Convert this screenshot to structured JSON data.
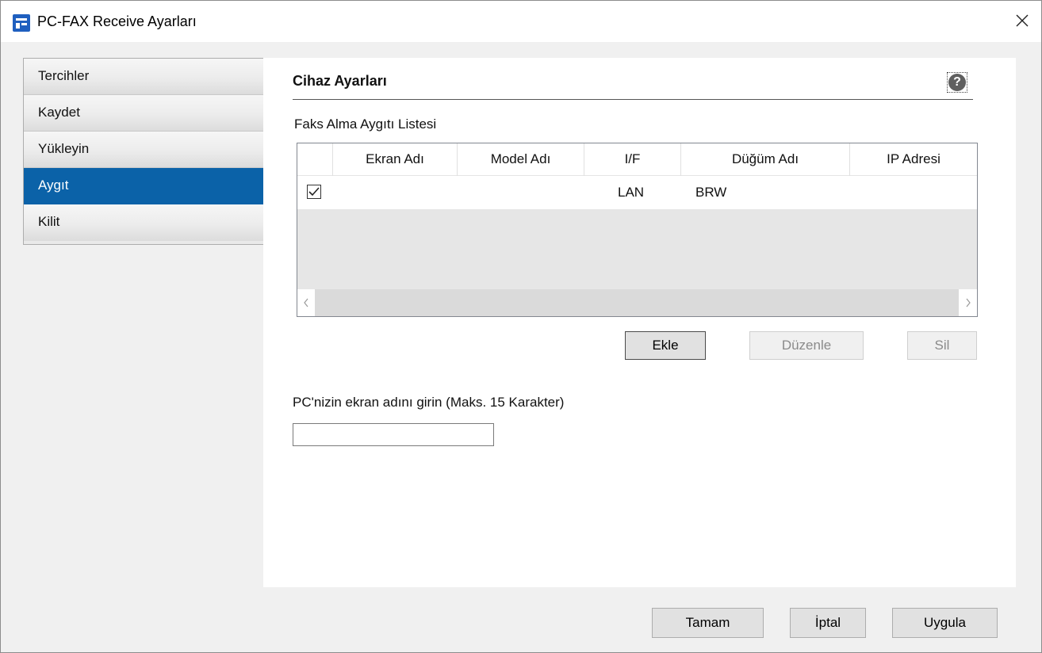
{
  "window": {
    "title": "PC-FAX Receive Ayarları",
    "icon": "app-icon",
    "close_icon": "close-icon"
  },
  "sidebar": {
    "items": [
      {
        "label": "Tercihler",
        "active": false
      },
      {
        "label": "Kaydet",
        "active": false
      },
      {
        "label": "Yükleyin",
        "active": false
      },
      {
        "label": "Aygıt",
        "active": true
      },
      {
        "label": "Kilit",
        "active": false
      }
    ],
    "active_color": "#0b62a8"
  },
  "panel": {
    "section_title": "Cihaz Ayarları",
    "help_icon": "help-icon",
    "list_label": "Faks Alma Aygıtı Listesi",
    "table": {
      "columns": [
        "Ekran Adı",
        "Model Adı",
        "I/F",
        "Düğüm Adı",
        "IP Adresi"
      ],
      "rows": [
        {
          "checked": true,
          "screen_name": "",
          "model_name": "",
          "interface": "LAN",
          "node_name": "BRW",
          "ip_address": ""
        }
      ]
    },
    "buttons": {
      "add": "Ekle",
      "edit": "Düzenle",
      "delete": "Sil"
    },
    "input": {
      "label": "PC'nizin ekran adını girin (Maks. 15 Karakter)",
      "value": ""
    }
  },
  "footer": {
    "ok": "Tamam",
    "cancel": "İptal",
    "apply": "Uygula"
  }
}
